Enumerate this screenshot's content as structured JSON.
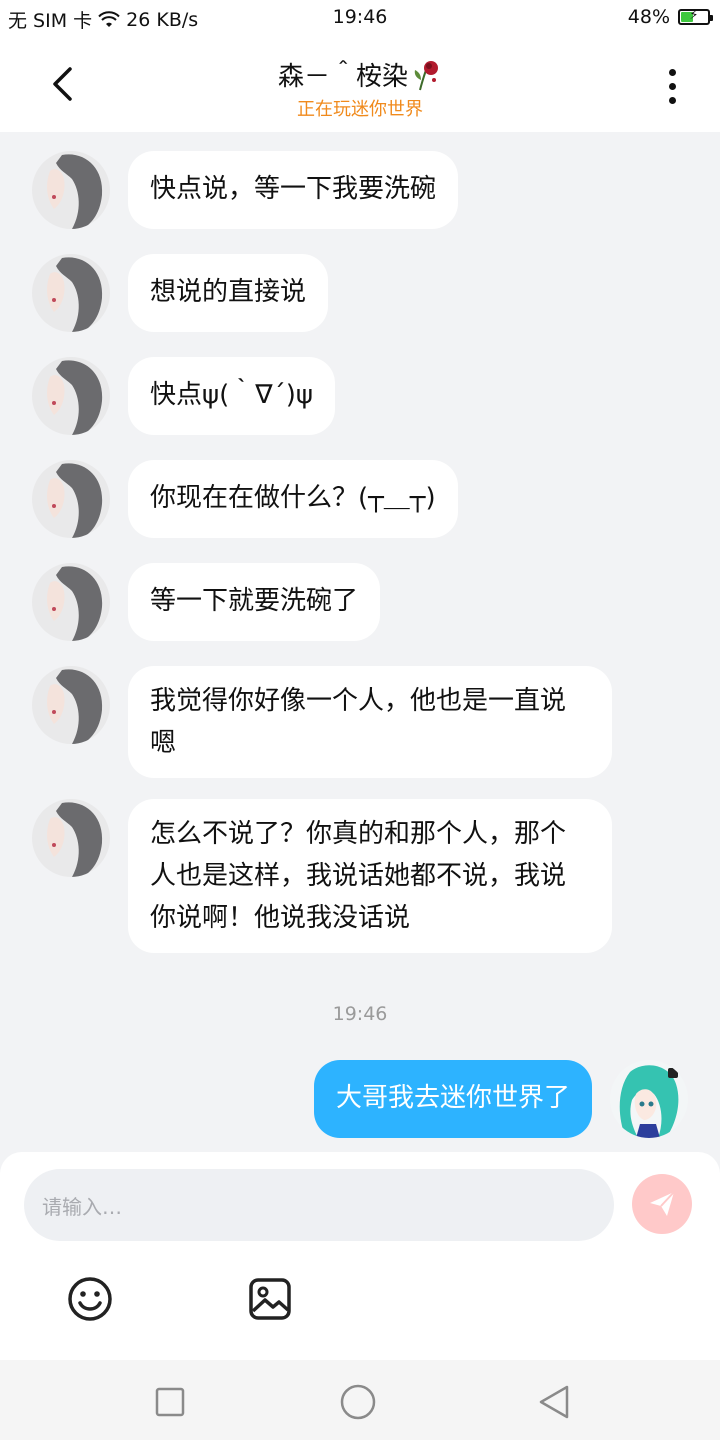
{
  "status": {
    "carrier": "无 SIM 卡",
    "speed": "26 KB/s",
    "time": "19:46",
    "battery": "48%",
    "battery_level": 0.48
  },
  "header": {
    "title": "森－＾桉染",
    "subtitle": "正在玩迷你世界"
  },
  "messages": [
    {
      "text": "快点说，等一下我要洗碗"
    },
    {
      "text": "想说的直接说"
    },
    {
      "text": "快点ψ(｀∇´)ψ"
    },
    {
      "text": "你现在在做什么？(┬＿┬)"
    },
    {
      "text": "等一下就要洗碗了"
    },
    {
      "text": "我觉得你好像一个人，他也是一直说嗯"
    },
    {
      "text": "怎么不说了？你真的和那个人，那个人也是这样，我说话她都不说，我说你说啊！他说我没话说"
    }
  ],
  "timestamp": "19:46",
  "my_message": {
    "text": "大哥我去迷你世界了"
  },
  "input": {
    "placeholder": "请输入…"
  },
  "colors": {
    "accent": "#2db3ff",
    "subtitle": "#f08a1c",
    "send_disabled": "#ffc9c9"
  }
}
